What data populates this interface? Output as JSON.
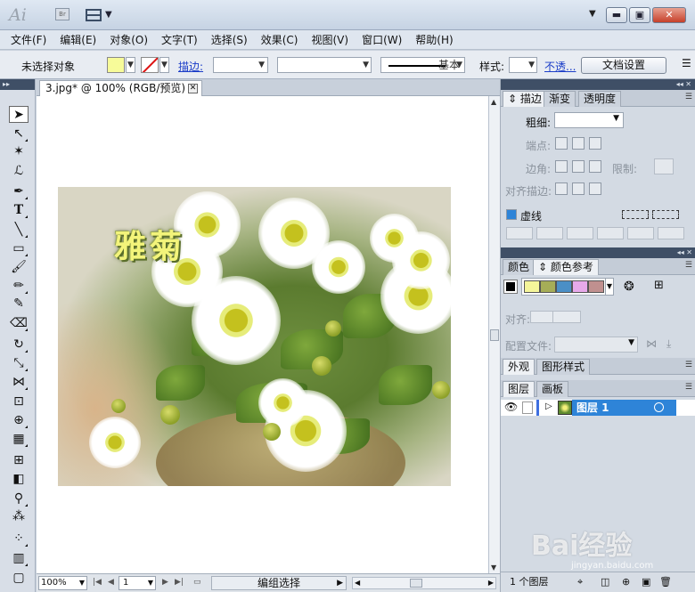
{
  "app": {
    "logo": "Ai",
    "bridge_label": "Br",
    "window_buttons": {
      "minimize": "▬",
      "maximize": "▣",
      "close": "✕"
    }
  },
  "menu": [
    "文件(F)",
    "编辑(E)",
    "对象(O)",
    "文字(T)",
    "选择(S)",
    "效果(C)",
    "视图(V)",
    "窗口(W)",
    "帮助(H)"
  ],
  "control_bar": {
    "selection_status": "未选择对象",
    "fill_color": "#f7fb99",
    "stroke_label": "描边:",
    "brush_label": "基本",
    "style_label": "样式:",
    "opacity_link": "不透...",
    "doc_settings_button": "文档设置"
  },
  "document": {
    "tab_title": "3.jpg* @ 100% (RGB/预览)",
    "image_text": "雅菊"
  },
  "status_bar": {
    "zoom": "100%",
    "page": "1",
    "status_text": "编组选择"
  },
  "panels": {
    "stroke": {
      "tabs": [
        "描边",
        "渐变",
        "透明度"
      ],
      "weight_label": "粗细:",
      "cap_label": "端点:",
      "corner_label": "边角:",
      "limit_label": "限制:",
      "align_label": "对齐描边:",
      "dashed_label": "虚线"
    },
    "color": {
      "tabs": [
        "颜色",
        "颜色参考"
      ],
      "harmony_swatches": [
        "#f4f59a",
        "#a6ad57",
        "#4b8fc6",
        "#e7a9ea",
        "#c0908f"
      ],
      "align_label": "对齐:",
      "profile_label": "配置文件:"
    },
    "appearance": {
      "tabs": [
        "外观",
        "图形样式"
      ]
    },
    "layers": {
      "tabs": [
        "图层",
        "画板"
      ],
      "layer_name": "图层 1",
      "layer_count": "1 个图层"
    }
  },
  "watermark": {
    "brand": "Bai经验",
    "url": "jingyan.baidu.com"
  }
}
